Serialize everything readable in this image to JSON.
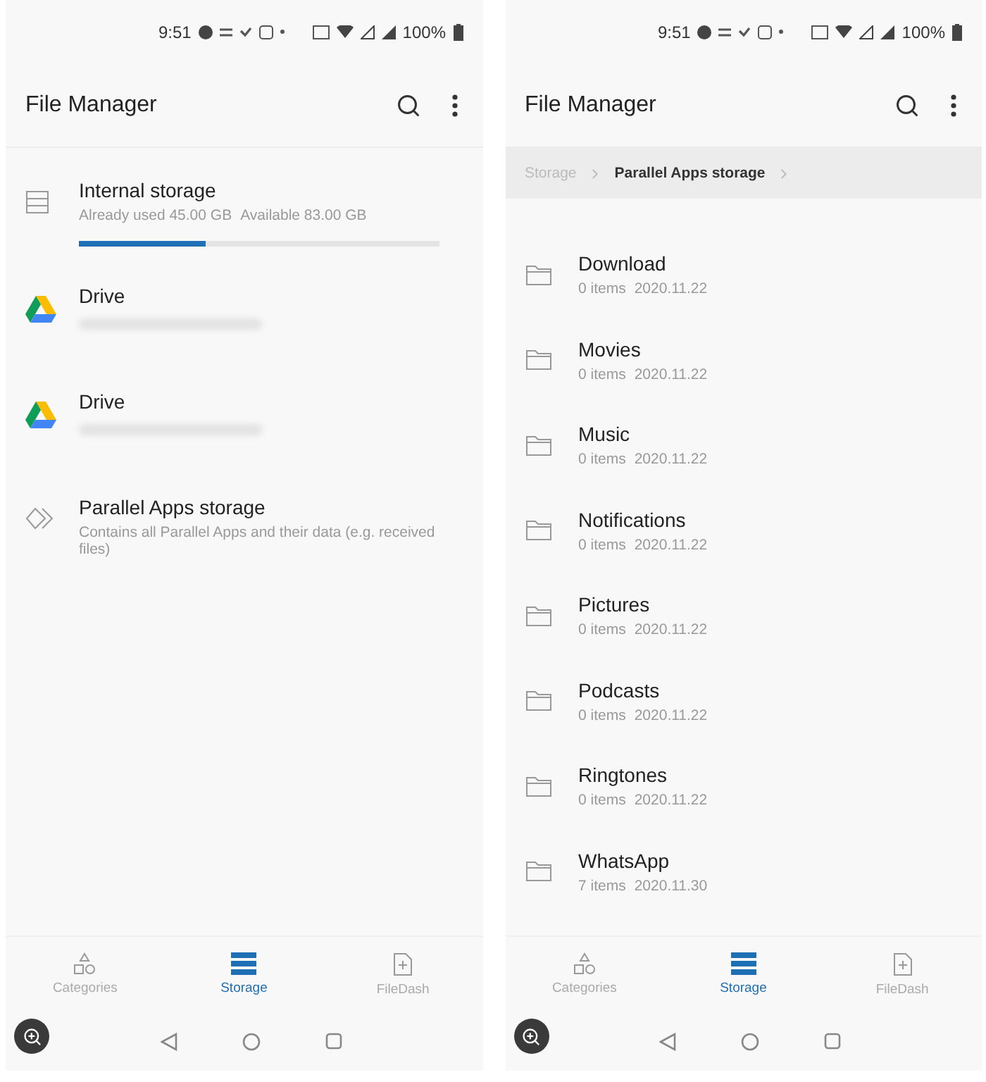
{
  "screens": [
    {
      "status_bar": {
        "time": "9:51",
        "battery": "100%"
      },
      "app_bar": {
        "title": "File Manager"
      },
      "storage_list": [
        {
          "kind": "internal",
          "title": "Internal storage",
          "used": "Already used 45.00 GB",
          "available": "Available 83.00 GB",
          "level": 0.35
        },
        {
          "kind": "drive",
          "title": "Drive"
        },
        {
          "kind": "drive",
          "title": "Drive"
        },
        {
          "kind": "parallel",
          "title": "Parallel Apps storage",
          "description": "Contains all Parallel Apps and their data (e.g. received files)"
        }
      ],
      "bottom_nav": [
        {
          "label": "Categories",
          "selected": false
        },
        {
          "label": "Storage",
          "selected": true
        },
        {
          "label": "FileDash",
          "selected": false
        }
      ]
    },
    {
      "status_bar": {
        "time": "9:51",
        "battery": "100%"
      },
      "app_bar": {
        "title": "File Manager"
      },
      "breadcrumb": [
        {
          "label": "Storage",
          "selected": false
        },
        {
          "label": "Parallel Apps storage",
          "selected": true
        }
      ],
      "folders": [
        {
          "name": "Download",
          "count": "0 items",
          "date": "2020.11.22"
        },
        {
          "name": "Movies",
          "count": "0 items",
          "date": "2020.11.22"
        },
        {
          "name": "Music",
          "count": "0 items",
          "date": "2020.11.22"
        },
        {
          "name": "Notifications",
          "count": "0 items",
          "date": "2020.11.22"
        },
        {
          "name": "Pictures",
          "count": "0 items",
          "date": "2020.11.22"
        },
        {
          "name": "Podcasts",
          "count": "0 items",
          "date": "2020.11.22"
        },
        {
          "name": "Ringtones",
          "count": "0 items",
          "date": "2020.11.22"
        },
        {
          "name": "WhatsApp",
          "count": "7 items",
          "date": "2020.11.30"
        }
      ],
      "bottom_nav": [
        {
          "label": "Categories",
          "selected": false
        },
        {
          "label": "Storage",
          "selected": true
        },
        {
          "label": "FileDash",
          "selected": false
        }
      ]
    }
  ]
}
